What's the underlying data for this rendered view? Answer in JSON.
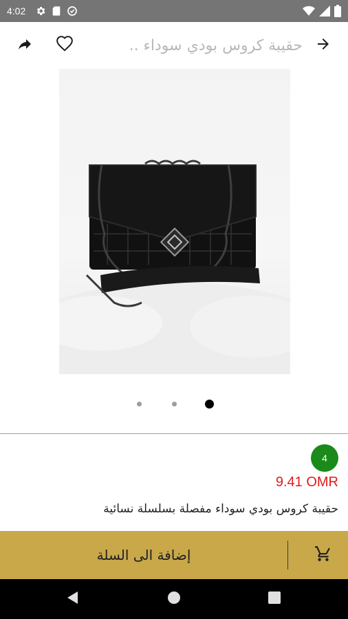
{
  "status_bar": {
    "time": "4:02",
    "icons": [
      "gear-icon",
      "sd-card-icon",
      "sync-icon",
      "wifi-icon",
      "signal-icon",
      "battery-icon"
    ]
  },
  "toolbar": {
    "title": "حقيبة كروس بودي سوداء ..",
    "icons": [
      "share-icon",
      "heart-icon",
      "arrow-forward-icon"
    ]
  },
  "product": {
    "image_pages": 3,
    "active_page": 3,
    "rating": "4",
    "price": "9.41 OMR",
    "name": "حقيبة كروس بودي سوداء مفصلة بسلسلة نسائية"
  },
  "cart": {
    "add_label": "إضافة الى السلة",
    "icon": "cart-icon"
  },
  "colors": {
    "accent_gold": "#c9a84a",
    "price_red": "#e01a1a",
    "rating_green": "#1a8a1a",
    "status_bar": "#757575"
  },
  "nav_bar": {
    "icons": [
      "back-icon",
      "home-icon",
      "recents-icon"
    ]
  }
}
